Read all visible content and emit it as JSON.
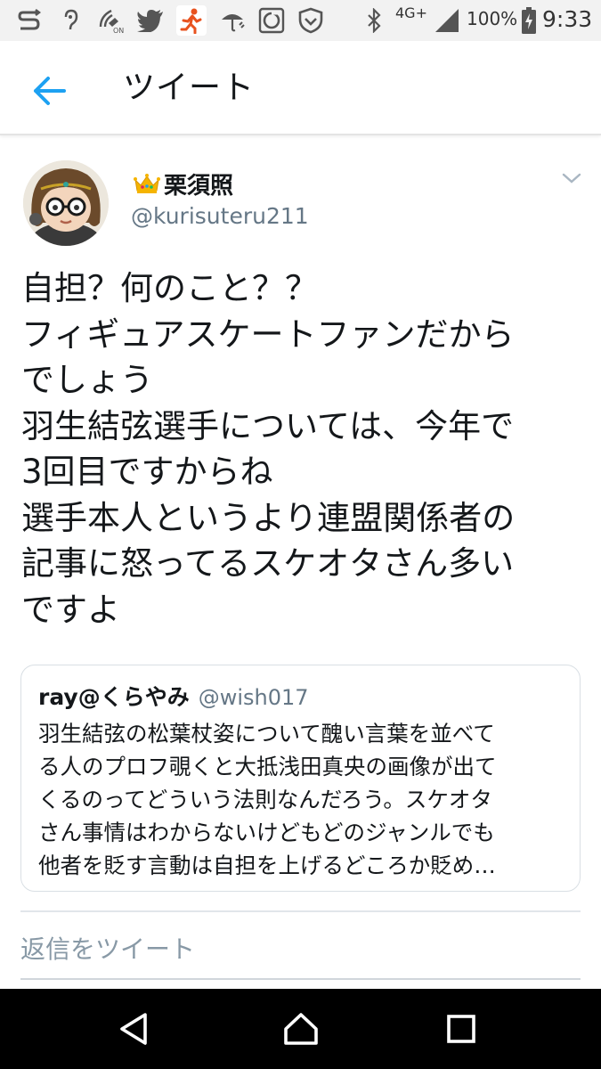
{
  "status_bar": {
    "network": "4G+",
    "battery": "100%",
    "time": "9:33",
    "icons": [
      "sync-icon",
      "hearing-aid-icon",
      "wifi-calling-icon",
      "twitter-icon",
      "running-app-icon",
      "umbrella-icon",
      "phone-manager-icon",
      "shield-icon",
      "bluetooth-icon",
      "signal-icon",
      "battery-icon"
    ]
  },
  "app_bar": {
    "title": "ツイート",
    "back_icon": "arrow-left-icon"
  },
  "tweet": {
    "display_name": "栗須照",
    "handle": "@kurisuteru211",
    "lines": [
      "自担？何のこと？？",
      "フィギュアスケートファンだから",
      "でしょう",
      "羽生結弦選手については、今年で",
      "3回目ですからね",
      "選手本人というより連盟関係者の",
      "記事に怒ってるスケオタさん多い",
      "ですよ"
    ]
  },
  "quote": {
    "name": "ray@くらやみ",
    "handle": "@wish017",
    "lines": [
      "羽生結弦の松葉杖姿について醜い言葉を並べて",
      "る人のプロフ覗くと大抵浅田真央の画像が出て",
      "くるのってどういう法則なんだろう。スケオタ",
      "さん事情はわからないけどもどのジャンルでも",
      "他者を貶す言動は自担を上げるどころか貶め…"
    ]
  },
  "reply": {
    "placeholder": "返信をツイート"
  },
  "colors": {
    "accent": "#1da1f2",
    "text": "#14171a",
    "secondary": "#657786",
    "border": "#d9dfe4"
  }
}
